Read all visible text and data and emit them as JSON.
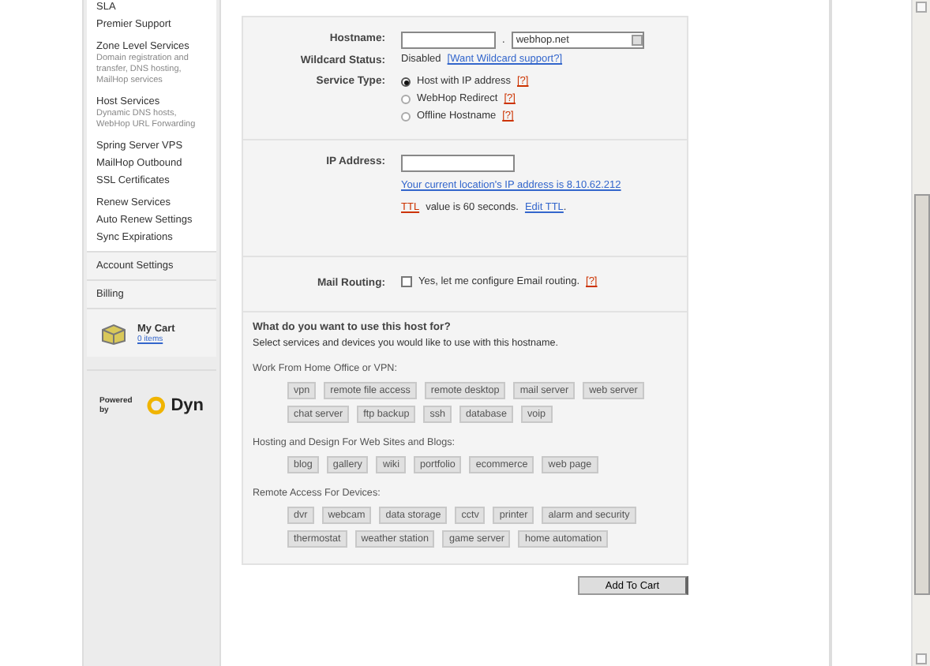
{
  "sidebar": {
    "link_groups": [
      {
        "links": [
          {
            "label": "SLA"
          },
          {
            "label": "Premier Support"
          }
        ]
      },
      {
        "links": [
          {
            "label": "Zone Level Services",
            "description": "Domain registration and transfer, DNS hosting, MailHop services"
          }
        ]
      },
      {
        "links": [
          {
            "label": "Host Services",
            "description": "Dynamic DNS hosts, WebHop URL Forwarding"
          }
        ]
      },
      {
        "links": [
          {
            "label": "Spring Server VPS"
          },
          {
            "label": "MailHop Outbound"
          },
          {
            "label": "SSL Certificates"
          }
        ]
      },
      {
        "links": [
          {
            "label": "Renew Services"
          },
          {
            "label": "Auto Renew Settings"
          },
          {
            "label": "Sync Expirations"
          }
        ]
      }
    ],
    "sections": [
      {
        "label": "Account Settings"
      },
      {
        "label": "Billing"
      }
    ],
    "cart": {
      "title": "My Cart",
      "count": "0 items"
    },
    "powered_by": {
      "label": "Powered by",
      "brand": "Dyn"
    }
  },
  "form": {
    "hostname": {
      "label": "Hostname:",
      "separator": ".",
      "domain": "webhop.net"
    },
    "wildcard": {
      "label": "Wildcard Status:",
      "status": "Disabled",
      "link": "[Want Wildcard support?]"
    },
    "service_type": {
      "label": "Service Type:",
      "options": [
        {
          "label": "Host with IP address",
          "help": "[?]",
          "selected": true
        },
        {
          "label": "WebHop Redirect",
          "help": "[?]",
          "selected": false
        },
        {
          "label": "Offline Hostname",
          "help": "[?]",
          "selected": false
        }
      ]
    },
    "ip_address": {
      "label": "IP Address:",
      "location_link": "Your current location's IP address is 8.10.62.212",
      "ttl_link": "TTL",
      "ttl_text": "value is 60 seconds.",
      "edit_link": "Edit TTL",
      "end": "."
    },
    "mail_routing": {
      "label": "Mail Routing:",
      "checked": false,
      "text": "Yes, let me configure Email routing.",
      "help": "[?]"
    },
    "usage": {
      "title": "What do you want to use this host for?",
      "subtitle": "Select services and devices you would like to use with this hostname.",
      "groups": [
        {
          "label": "Work From Home Office or VPN:",
          "tags": [
            "vpn",
            "remote file access",
            "remote desktop",
            "mail server",
            "web server",
            "chat server",
            "ftp backup",
            "ssh",
            "database",
            "voip"
          ]
        },
        {
          "label": "Hosting and Design For Web Sites and Blogs:",
          "tags": [
            "blog",
            "gallery",
            "wiki",
            "portfolio",
            "ecommerce",
            "web page"
          ]
        },
        {
          "label": "Remote Access For Devices:",
          "tags": [
            "dvr",
            "webcam",
            "data storage",
            "cctv",
            "printer",
            "alarm and security",
            "thermostat",
            "weather station",
            "game server",
            "home automation"
          ]
        }
      ]
    },
    "submit": "Add To Cart"
  }
}
